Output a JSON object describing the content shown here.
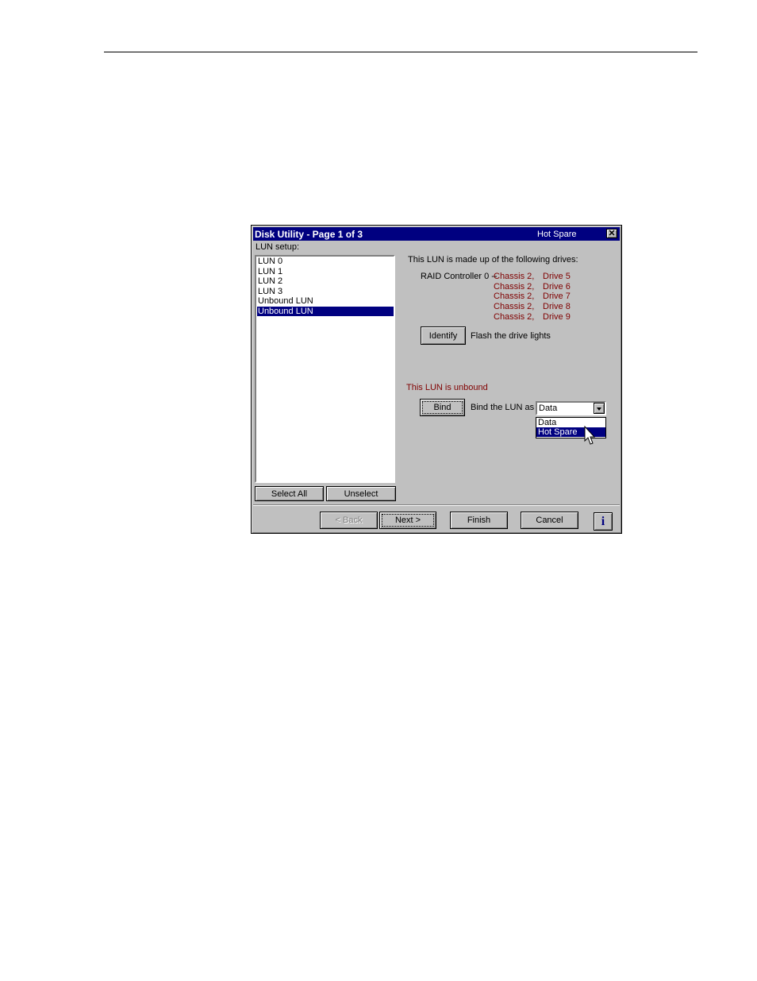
{
  "window": {
    "title": "Disk Utility - Page 1 of 3",
    "selection_indicator": "Hot Spare",
    "close_glyph": "✕"
  },
  "lun_setup": {
    "label": "LUN setup:",
    "items": [
      {
        "label": "LUN 0"
      },
      {
        "label": "LUN 1"
      },
      {
        "label": "LUN 2"
      },
      {
        "label": "LUN 3"
      },
      {
        "label": "Unbound LUN"
      },
      {
        "label": "Unbound LUN"
      }
    ],
    "selected_index": 5,
    "select_all_label": "Select All",
    "unselect_label": "Unselect"
  },
  "drives": {
    "heading": "This LUN is made up of the following drives:",
    "controller": "RAID Controller 0 --",
    "rows": [
      {
        "chassis": "Chassis 2,",
        "drive": "Drive 5"
      },
      {
        "chassis": "Chassis 2,",
        "drive": "Drive 6"
      },
      {
        "chassis": "Chassis 2,",
        "drive": "Drive 7"
      },
      {
        "chassis": "Chassis 2,",
        "drive": "Drive 8"
      },
      {
        "chassis": "Chassis 2,",
        "drive": "Drive 9"
      }
    ],
    "identify_label": "Identify",
    "identify_desc": "Flash the drive lights"
  },
  "bind": {
    "status": "This LUN is unbound",
    "button_label": "Bind",
    "desc": "Bind the LUN as",
    "selected_value": "Data",
    "options": [
      "Data",
      "Hot Spare"
    ],
    "highlighted_option": "Hot Spare"
  },
  "footer": {
    "back_label": "< Back",
    "next_label": "Next >",
    "finish_label": "Finish",
    "cancel_label": "Cancel",
    "info_glyph": "i"
  },
  "colors": {
    "title_bar": "#000080",
    "face": "#c0c0c0",
    "accent_text": "#800000"
  },
  "icons": {
    "close": "close-icon",
    "dropdown": "chevron-down-icon",
    "info": "info-icon",
    "cursor": "mouse-pointer-icon"
  }
}
